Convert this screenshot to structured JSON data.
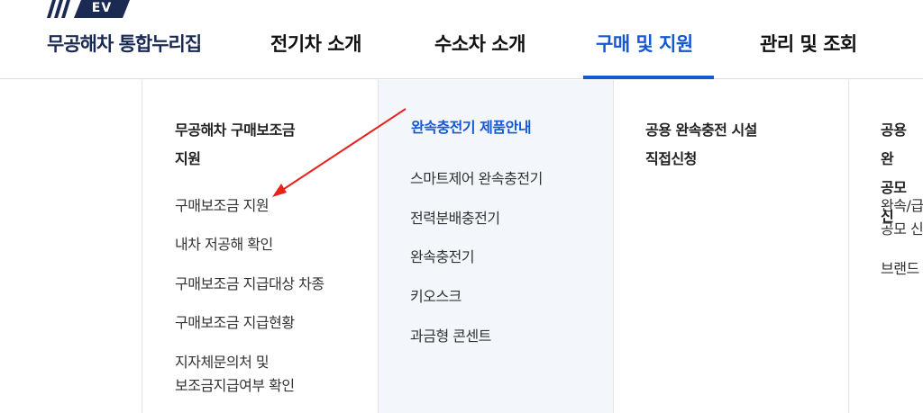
{
  "header": {
    "logo_badge": "EV",
    "site_title": "무공해차 통합누리집",
    "nav": [
      {
        "label": "전기차 소개",
        "active": false
      },
      {
        "label": "수소차 소개",
        "active": false
      },
      {
        "label": "구매 및 지원",
        "active": true
      },
      {
        "label": "관리 및 조회",
        "active": false
      }
    ]
  },
  "menu": {
    "columns": [
      {
        "title_line1": "무공해차 구매보조금",
        "title_line2": "지원",
        "items": [
          "구매보조금 지원",
          "내차 저공해 확인",
          "구매보조금 지급대상 차종",
          "구매보조금 지급현황"
        ],
        "last_item_line1": "지자체문의처 및",
        "last_item_line2": "보조금지급여부 확인"
      },
      {
        "title": "완속충전기 제품안내",
        "items": [
          "스마트제어 완속충전기",
          "전력분배충전기",
          "완속충전기",
          "키오스크",
          "과금형 콘센트"
        ]
      },
      {
        "title_line1": "공용 완속충전 시설",
        "title_line2": "직접신청"
      },
      {
        "title_line1": "공용 완",
        "title_line2": "공모 신",
        "item1_line1": "완속/급",
        "item1_line2": "공모 신",
        "item2": "브랜드"
      }
    ]
  },
  "colors": {
    "accent": "#1558d6",
    "brand_navy": "#1b2a52",
    "highlight_bg": "#f3f7fc",
    "annotation_arrow": "#e8211b"
  }
}
